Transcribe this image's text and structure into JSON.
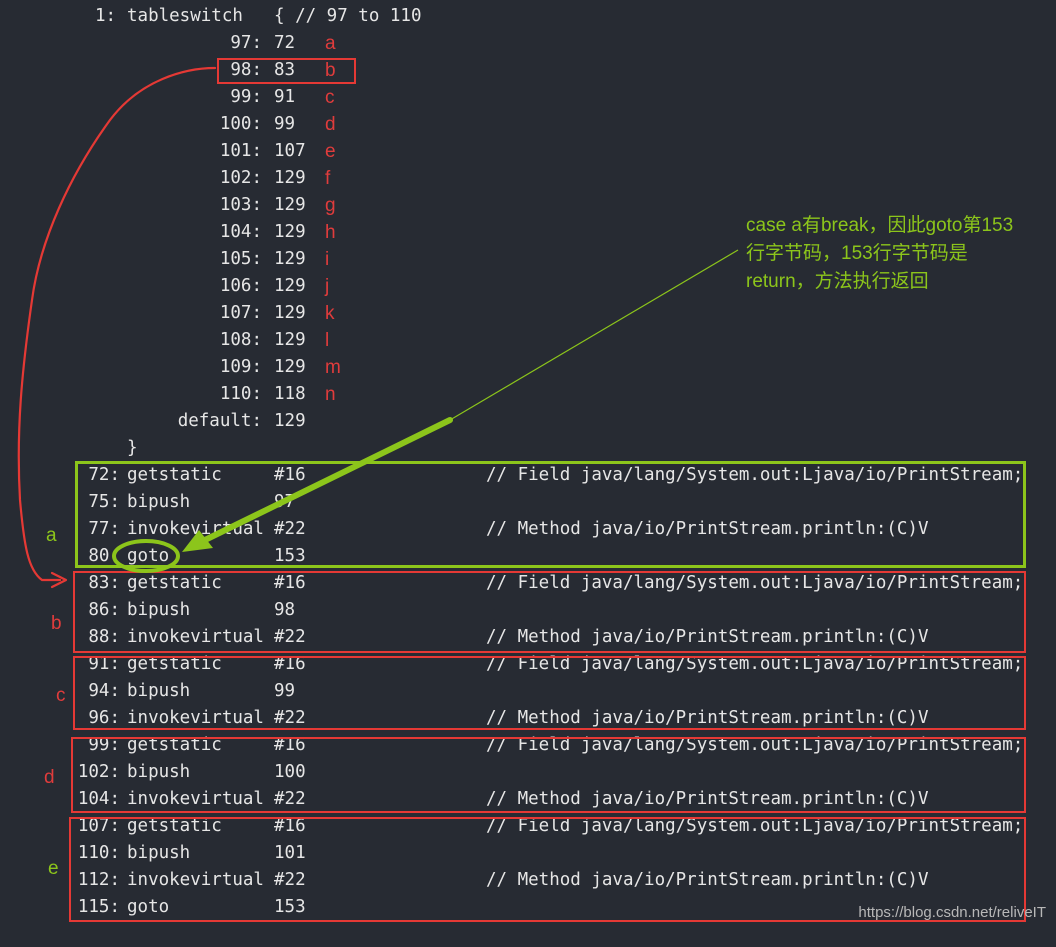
{
  "header": {
    "index": "1:",
    "instruction": "tableswitch",
    "comment": "{ // 97 to 110"
  },
  "switch_entries": [
    {
      "key": "97:",
      "target": "72",
      "letter": "a"
    },
    {
      "key": "98:",
      "target": "83",
      "letter": "b"
    },
    {
      "key": "99:",
      "target": "91",
      "letter": "c"
    },
    {
      "key": "100:",
      "target": "99",
      "letter": "d"
    },
    {
      "key": "101:",
      "target": "107",
      "letter": "e"
    },
    {
      "key": "102:",
      "target": "129",
      "letter": "f"
    },
    {
      "key": "103:",
      "target": "129",
      "letter": "g"
    },
    {
      "key": "104:",
      "target": "129",
      "letter": "h"
    },
    {
      "key": "105:",
      "target": "129",
      "letter": "i"
    },
    {
      "key": "106:",
      "target": "129",
      "letter": "j"
    },
    {
      "key": "107:",
      "target": "129",
      "letter": "k"
    },
    {
      "key": "108:",
      "target": "129",
      "letter": "l"
    },
    {
      "key": "109:",
      "target": "129",
      "letter": "m"
    },
    {
      "key": "110:",
      "target": "118",
      "letter": "n"
    },
    {
      "key": "default:",
      "target": "129",
      "letter": ""
    }
  ],
  "closing_brace": "}",
  "instructions": [
    {
      "pos": "72:",
      "op": "getstatic",
      "arg": "#16",
      "comment": "// Field java/lang/System.out:Ljava/io/PrintStream;"
    },
    {
      "pos": "75:",
      "op": "bipush",
      "arg": "97",
      "comment": ""
    },
    {
      "pos": "77:",
      "op": "invokevirtual",
      "arg": "#22",
      "comment": "// Method java/io/PrintStream.println:(C)V"
    },
    {
      "pos": "80:",
      "op": "goto",
      "arg": "153",
      "comment": ""
    },
    {
      "pos": "83:",
      "op": "getstatic",
      "arg": "#16",
      "comment": "// Field java/lang/System.out:Ljava/io/PrintStream;"
    },
    {
      "pos": "86:",
      "op": "bipush",
      "arg": "98",
      "comment": ""
    },
    {
      "pos": "88:",
      "op": "invokevirtual",
      "arg": "#22",
      "comment": "// Method java/io/PrintStream.println:(C)V"
    },
    {
      "pos": "91:",
      "op": "getstatic",
      "arg": "#16",
      "comment": "// Field java/lang/System.out:Ljava/io/PrintStream;"
    },
    {
      "pos": "94:",
      "op": "bipush",
      "arg": "99",
      "comment": ""
    },
    {
      "pos": "96:",
      "op": "invokevirtual",
      "arg": "#22",
      "comment": "// Method java/io/PrintStream.println:(C)V"
    },
    {
      "pos": "99:",
      "op": "getstatic",
      "arg": "#16",
      "comment": "// Field java/lang/System.out:Ljava/io/PrintStream;"
    },
    {
      "pos": "102:",
      "op": "bipush",
      "arg": "100",
      "comment": ""
    },
    {
      "pos": "104:",
      "op": "invokevirtual",
      "arg": "#22",
      "comment": "// Method java/io/PrintStream.println:(C)V"
    },
    {
      "pos": "107:",
      "op": "getstatic",
      "arg": "#16",
      "comment": "// Field java/lang/System.out:Ljava/io/PrintStream;"
    },
    {
      "pos": "110:",
      "op": "bipush",
      "arg": "101",
      "comment": ""
    },
    {
      "pos": "112:",
      "op": "invokevirtual",
      "arg": "#22",
      "comment": "// Method java/io/PrintStream.println:(C)V"
    },
    {
      "pos": "115:",
      "op": "goto",
      "arg": "153",
      "comment": ""
    }
  ],
  "case_groups": [
    {
      "letter": "a",
      "color": "#8cc51b"
    },
    {
      "letter": "b",
      "color": "#e03c3c"
    },
    {
      "letter": "c",
      "color": "#e03c3c"
    },
    {
      "letter": "d",
      "color": "#e03c3c"
    },
    {
      "letter": "e",
      "color": "#8cc51b"
    }
  ],
  "annotation": {
    "line1": "case a有break，因此goto第153",
    "line2": "行字节码，153行字节码是",
    "line3": "return，方法执行返回"
  },
  "watermark": "https://blog.csdn.net/reliveIT",
  "colors": {
    "background": "#272b33",
    "text": "#e6e6e6",
    "red": "#e53935",
    "green": "#8cc51b"
  }
}
